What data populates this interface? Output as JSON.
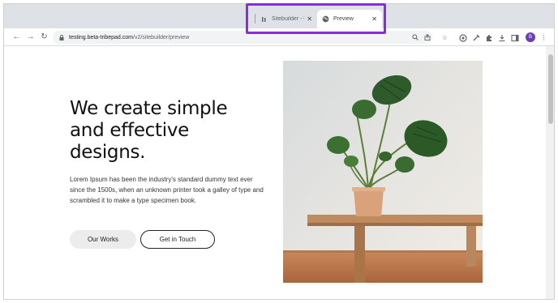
{
  "browser": {
    "tabs": [
      {
        "title": "Sitebuilder - D",
        "active": false
      },
      {
        "title": "Preview",
        "active": true
      }
    ],
    "url_host": "testing.beta-tribepad.com",
    "url_path": "/v2/sitebuilder/preview",
    "profile_initial": "B",
    "highlight_color": "#8a2be2"
  },
  "icons": {
    "back": "arrow-left-icon",
    "forward": "arrow-right-icon",
    "reload": "reload-icon",
    "lock": "lock-icon",
    "zoom": "search-icon",
    "share": "share-icon",
    "bookmark": "star-icon",
    "menu": "more-vertical-icon"
  },
  "hero": {
    "headline_line1": "We create simple",
    "headline_line2": "and effective",
    "headline_line3": "designs.",
    "body": "Lorem Ipsum has been the industry's standard dummy text ever since the 1500s, when an unknown printer took a galley of type and scrambled it to make a type specimen book.",
    "primary_button": "Our Works",
    "secondary_button": "Get in Touch"
  }
}
